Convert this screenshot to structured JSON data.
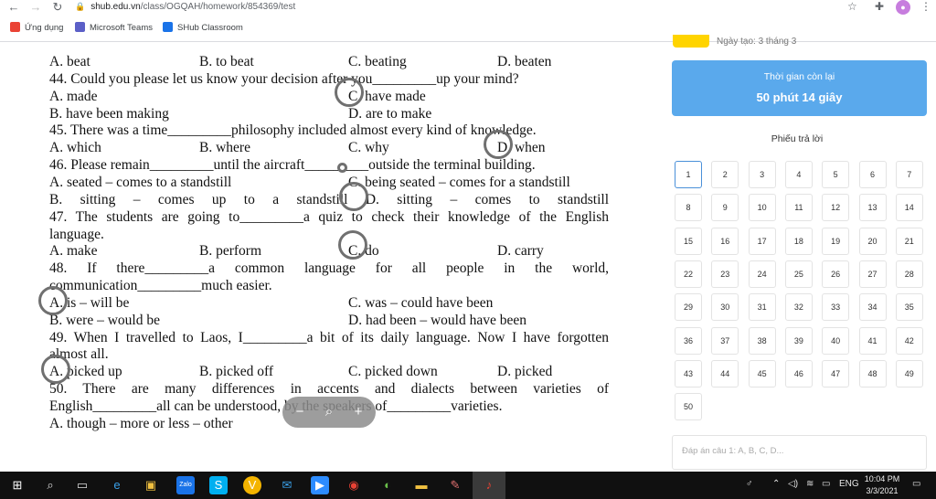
{
  "browser": {
    "url_host": "shub.edu.vn",
    "url_path": "/class/OGQAH/homework/854369/test",
    "bookmarks": [
      {
        "label": "Ứng dụng",
        "icon": "apps-grid-icon",
        "color": "#ea4335"
      },
      {
        "label": "Microsoft Teams",
        "icon": "teams-icon",
        "color": "#5b5fc7"
      },
      {
        "label": "SHub Classroom",
        "icon": "shub-icon",
        "color": "#1a73e8"
      }
    ]
  },
  "document": {
    "lines": [
      {
        "type": "options",
        "opts": [
          "A. beat",
          "B. to beat",
          "C. beating",
          "D. beaten"
        ]
      },
      {
        "type": "text",
        "text": "44. Could you please let us know your decision after you_________up your mind?"
      },
      {
        "type": "options2",
        "opts": [
          "A. made",
          "",
          "C. have made",
          ""
        ]
      },
      {
        "type": "options2",
        "opts": [
          "B. have been making",
          "",
          "D. are to make",
          ""
        ]
      },
      {
        "type": "text",
        "text": "45. There was a time_________philosophy included almost every kind of knowledge."
      },
      {
        "type": "options",
        "opts": [
          "A. which",
          "B. where",
          "C. why",
          "D. when"
        ]
      },
      {
        "type": "text",
        "text": "46. Please remain_________until the aircraft_________outside the terminal building."
      },
      {
        "type": "options2",
        "opts": [
          "A. seated – comes to a standstill",
          "",
          "C. being seated – comes for a standstill",
          ""
        ]
      },
      {
        "type": "justify",
        "text": "B. sitting – comes up to a standstill D. sitting – comes to standstill"
      },
      {
        "type": "justify",
        "text": "47. The students are going to_________a quiz to check their knowledge of the English"
      },
      {
        "type": "text",
        "text": "language."
      },
      {
        "type": "options",
        "opts": [
          "A. make",
          "B. perform",
          "C. do",
          "D. carry"
        ]
      },
      {
        "type": "justify",
        "text": "48. If there_________a common language for all people in the world,"
      },
      {
        "type": "text",
        "text": "communication_________much easier."
      },
      {
        "type": "options2",
        "opts": [
          "A. is – will be",
          "",
          "C. was – could have been",
          ""
        ]
      },
      {
        "type": "options2",
        "opts": [
          "B. were – would be",
          "",
          "D. had been – would have been",
          ""
        ]
      },
      {
        "type": "justify",
        "text": "49. When I travelled to Laos, I_________a bit of its daily language. Now I have forgotten"
      },
      {
        "type": "text",
        "text": "almost all."
      },
      {
        "type": "options",
        "opts": [
          "A. picked up",
          "B. picked off",
          "C. picked down",
          "D. picked"
        ]
      },
      {
        "type": "justify",
        "text": "50. There are many differences in accents and dialects between varieties of"
      },
      {
        "type": "text",
        "text": "English_________all can be understood,          by the speakers of_________varieties."
      },
      {
        "type": "text",
        "text": "A. though – more or less – other"
      }
    ],
    "zoom": {
      "minus": "−",
      "search": "⌕",
      "plus": "+"
    }
  },
  "panel": {
    "created_label": "Ngày tạo: 3 tháng 3",
    "timer_label": "Thời gian còn lại",
    "timer_value": "50 phút 14 giây",
    "sheet_title": "Phiếu trả lời",
    "numbers": [
      "1",
      "2",
      "3",
      "4",
      "5",
      "6",
      "7",
      "8",
      "9",
      "10",
      "11",
      "12",
      "13",
      "14",
      "15",
      "16",
      "17",
      "18",
      "19",
      "20",
      "21",
      "22",
      "23",
      "24",
      "25",
      "26",
      "27",
      "28",
      "29",
      "30",
      "31",
      "32",
      "33",
      "34",
      "35",
      "36",
      "37",
      "38",
      "39",
      "40",
      "41",
      "42",
      "43",
      "44",
      "45",
      "46",
      "47",
      "48",
      "49",
      "50"
    ],
    "answer_placeholder": "Đáp án câu 1: A, B, C, D..."
  },
  "taskbar": {
    "lang": "ENG",
    "time": "10:04 PM",
    "date": "3/3/2021"
  }
}
